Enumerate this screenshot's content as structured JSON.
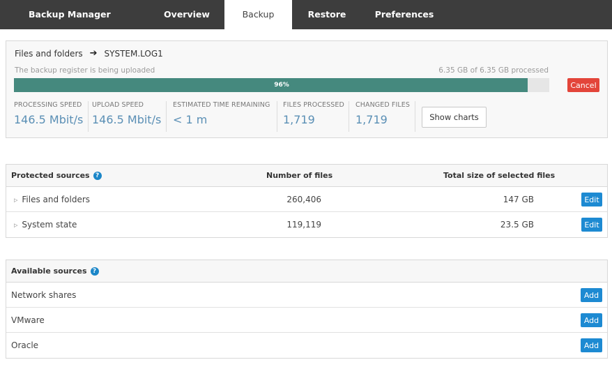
{
  "nav": {
    "brand": "Backup Manager",
    "tabs": [
      {
        "label": "Overview",
        "active": false
      },
      {
        "label": "Backup",
        "active": true
      },
      {
        "label": "Restore",
        "active": false
      },
      {
        "label": "Preferences",
        "active": false
      }
    ]
  },
  "progress": {
    "crumb_root": "Files and folders",
    "crumb_arrow": "➔",
    "crumb_current": "SYSTEM.LOG1",
    "status": "The backup register is being uploaded",
    "processed": "6.35 GB of 6.35 GB processed",
    "percent": 96,
    "percent_label": "96%",
    "cancel_label": "Cancel",
    "stats": [
      {
        "label": "PROCESSING SPEED",
        "value": "146.5 Mbit/s"
      },
      {
        "label": "UPLOAD SPEED",
        "value": "146.5 Mbit/s"
      },
      {
        "label": "ESTIMATED TIME REMAINING",
        "value": "< 1 m"
      },
      {
        "label": "FILES PROCESSED",
        "value": "1,719"
      },
      {
        "label": "CHANGED FILES",
        "value": "1,719"
      }
    ],
    "show_charts_label": "Show charts"
  },
  "protected": {
    "title": "Protected sources",
    "col_files": "Number of files",
    "col_size": "Total size of selected files",
    "edit_label": "Edit",
    "rows": [
      {
        "name": "Files and folders",
        "files": "260,406",
        "size": "147 GB"
      },
      {
        "name": "System state",
        "files": "119,119",
        "size": "23.5 GB"
      }
    ]
  },
  "available": {
    "title": "Available sources",
    "add_label": "Add",
    "rows": [
      {
        "name": "Network shares"
      },
      {
        "name": "VMware"
      },
      {
        "name": "Oracle"
      }
    ]
  },
  "colors": {
    "topbar": "#3d3d3d",
    "progress_fill": "#45897e",
    "cancel": "#e3453a",
    "action_blue": "#1d8ad2",
    "stat_value": "#5a8fb5"
  },
  "icons": {
    "help": "question-circle-icon",
    "expand": "triangle-right-icon",
    "arrow": "arrow-right-icon"
  }
}
